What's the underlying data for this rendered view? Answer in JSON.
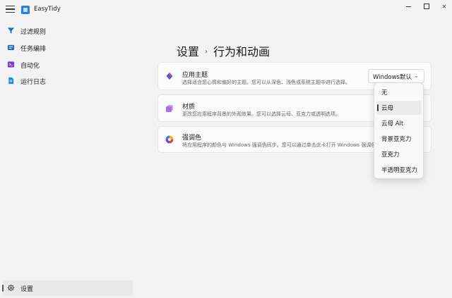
{
  "app": {
    "title": "EasyTidy"
  },
  "sidebar": {
    "items": [
      {
        "label": "过滤规则",
        "icon": "filter-icon"
      },
      {
        "label": "任务编排",
        "icon": "task-icon"
      },
      {
        "label": "自动化",
        "icon": "automation-icon"
      },
      {
        "label": "运行日志",
        "icon": "log-icon"
      }
    ],
    "footer": {
      "label": "设置",
      "icon": "gear-icon"
    }
  },
  "header": {
    "parent": "设置",
    "separator": "›",
    "current": "行为和动画"
  },
  "cards": [
    {
      "title": "应用主题",
      "description": "选择适合您心情和偏好的主题。您可以从深色、浅色或系统主题中进行选择。",
      "icon": "theme-icon"
    },
    {
      "title": "材质",
      "description": "更改您应用程序背景的外观效果。您可以选择云母、亚克力或透明选项。",
      "icon": "material-icon"
    },
    {
      "title": "强调色",
      "description": "将应用程序的颜色与 Windows 强调色同步。您可以通过单击此卡打开 Windows 强调色",
      "icon": "accent-color-icon"
    }
  ],
  "theme_select": {
    "value": "Windows默认",
    "chevron": "⌄"
  },
  "material_dropdown": {
    "options": [
      "无",
      "云母",
      "云母 Alt",
      "背景亚克力",
      "亚克力",
      "半透明亚克力"
    ],
    "selected": "云母"
  }
}
